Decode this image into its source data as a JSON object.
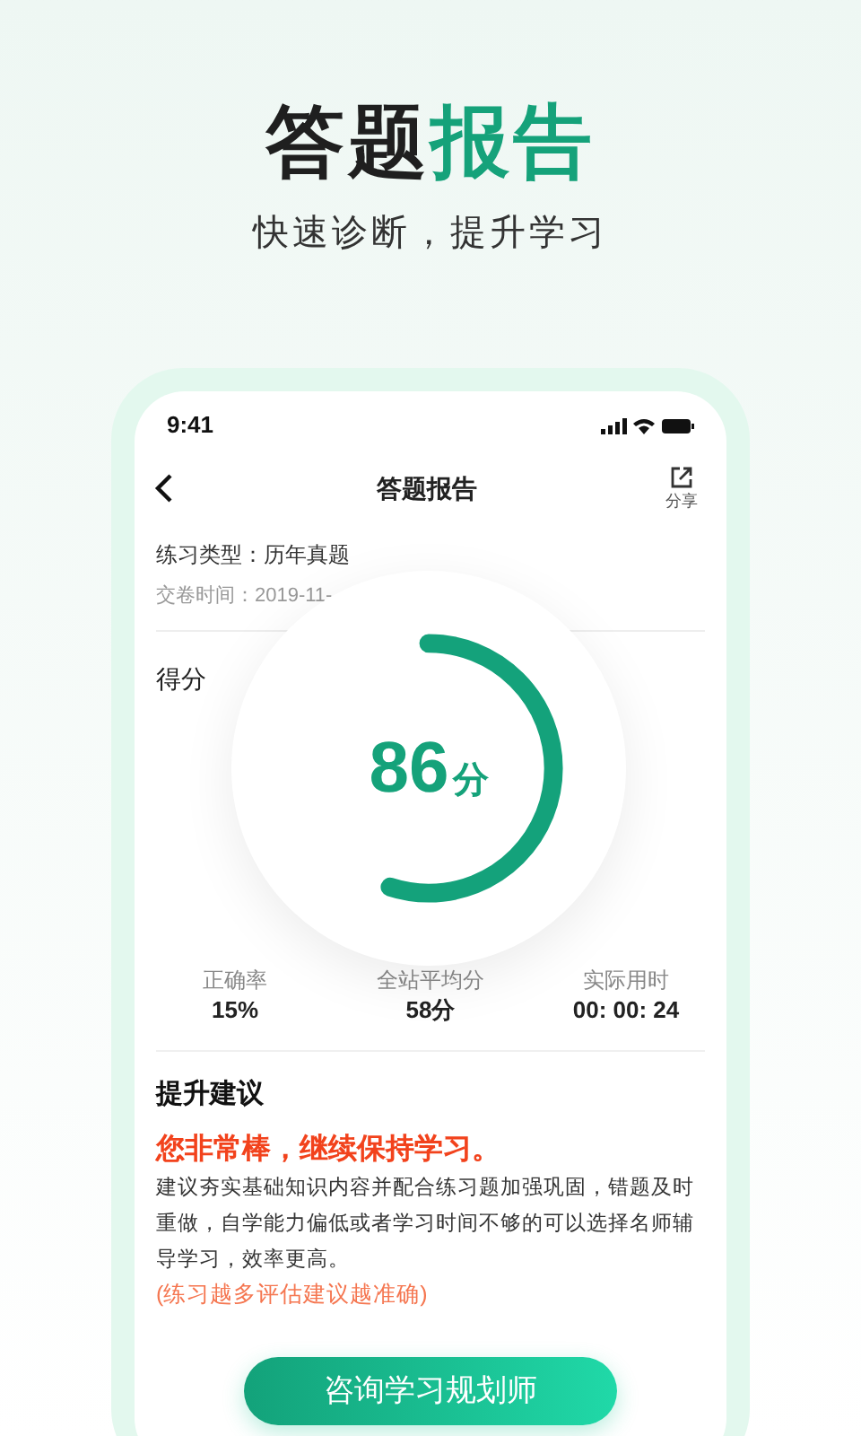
{
  "headline": [
    {
      "text": "答题",
      "color": "#1f1f1f"
    },
    {
      "text": "报告",
      "color": "#15a27a"
    }
  ],
  "subtitle": "快速诊断，提升学习",
  "status_bar": {
    "time": "9:41"
  },
  "nav": {
    "title": "答题报告",
    "share_label": "分享"
  },
  "info": {
    "practice_type": "练习类型：历年真题",
    "submit_time": "交卷时间：2019-11-"
  },
  "score": {
    "label": "得分",
    "value": "86",
    "unit": "分",
    "level": 0.55
  },
  "stats": [
    {
      "label": "正确率",
      "value": "15%"
    },
    {
      "label": "全站平均分",
      "value": "58分"
    },
    {
      "label": "实际用时",
      "value": "00: 00: 24"
    }
  ],
  "advice": {
    "title": "提升建议",
    "highlight": "您非常棒，继续保持学习。",
    "body": "建议夯实基础知识内容并配合练习题加强巩固，错题及时重做，自学能力偏低或者学习时间不够的可以选择名师辅导学习，效率更高。",
    "note": "(练习越多评估建议越准确)"
  },
  "button": "咨询学习规划师"
}
